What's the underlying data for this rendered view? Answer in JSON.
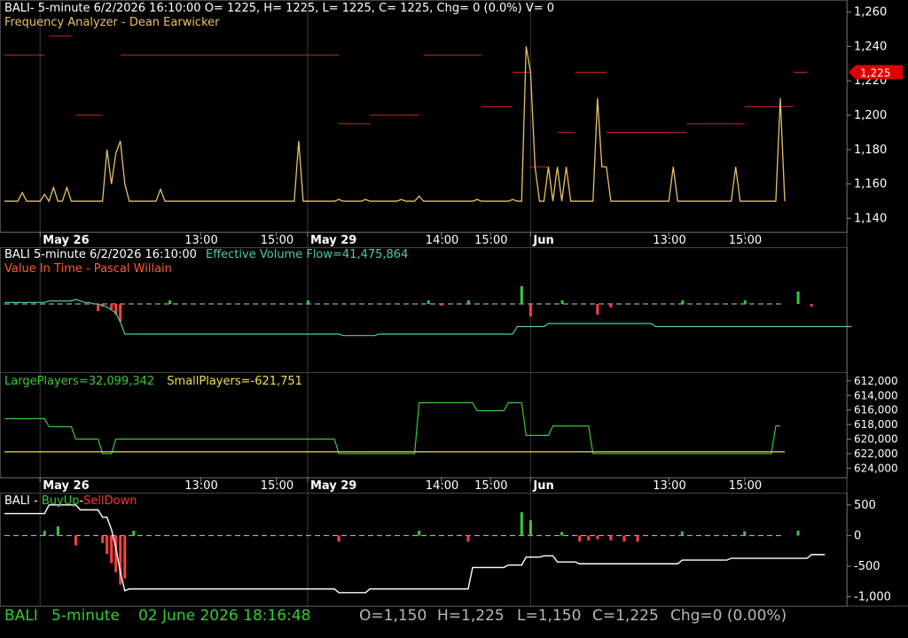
{
  "window": {
    "symbol": "BALI",
    "header1_prefix": "BALI- 5-minute 6/2/2026 16:10:00",
    "ohlc": "O= 1225, H= 1225, L= 1225, C= 1225, Chg= 0 (0.0%) V= 0",
    "indicator1": "Frequency Analyzer - Dean Earwicker",
    "header2": "BALI  5-minute  6/2/2026 16:10:00",
    "evf": "Effective Volume Flow=41,475,864",
    "indicator2": "Value In Time - Pascal Willain",
    "large_players": "LargePlayers=32,099,342",
    "small_players": "SmallPlayers=-621,751",
    "bu_prefix": "BALI - ",
    "bu_buy": "BuyUp",
    "bu_dash": "-",
    "bu_sell": "SellDown"
  },
  "status_bar": {
    "symbol": "BALI",
    "interval": "5-minute",
    "datetime": "02 June 2026 18:16:48",
    "open": "O=1,150",
    "high": "H=1,225",
    "low": "L=1,150",
    "close": "C=1,225",
    "change": "Chg=0 (0.00%)"
  },
  "colors": {
    "background": "#000000",
    "grid": "#3a3a3a",
    "price_line": "#e8c06a",
    "freq_red": "#d42020",
    "green": "#33cc33",
    "teal": "#4ec9b0",
    "red": "#ff4040",
    "white": "#ffffff",
    "yellow": "#f0e040",
    "last_price_badge": "#e00000"
  },
  "chart_data": [
    {
      "type": "line",
      "panel": "price",
      "y_axis_ticks": [
        "1,140",
        "1,160",
        "1,180",
        "1,200",
        "1,220",
        "1,240",
        "1,260"
      ],
      "ylim": [
        1132,
        1267
      ],
      "last_price_label": "1,225",
      "x_tick_labels": [
        "May 26",
        "13:00",
        "15:00",
        "May 29",
        "14:00",
        "15:00",
        "Jun",
        "13:00",
        "15:00"
      ],
      "series": [
        {
          "values": [
            1150,
            1150,
            1150,
            1150,
            1155,
            1150,
            1150,
            1150,
            1150,
            1154,
            1150,
            1158,
            1150,
            1150,
            1158,
            1150,
            1150,
            1150,
            1150,
            1150,
            1150,
            1150,
            1150,
            1180,
            1160,
            1178,
            1185,
            1160,
            1150,
            1150,
            1150,
            1150,
            1150,
            1150,
            1150,
            1157,
            1150,
            1150,
            1150,
            1150,
            1150,
            1150,
            1150,
            1150,
            1150,
            1150,
            1150,
            1150,
            1150,
            1150,
            1150,
            1150,
            1150,
            1150,
            1150,
            1150,
            1150,
            1150,
            1150,
            1150,
            1150,
            1150,
            1150,
            1150,
            1150,
            1150,
            1185,
            1150,
            1150,
            1150,
            1150,
            1150,
            1150,
            1150,
            1150,
            1151,
            1150,
            1150,
            1150,
            1150,
            1150,
            1151,
            1150,
            1150,
            1150,
            1150,
            1150,
            1150,
            1150,
            1151,
            1150,
            1150,
            1150,
            1153,
            1150,
            1150,
            1150,
            1150,
            1150,
            1150,
            1150,
            1150,
            1150,
            1150,
            1150,
            1150,
            1151,
            1150,
            1150,
            1150,
            1150,
            1150,
            1150,
            1150,
            1151,
            1150,
            1150,
            1240,
            1225,
            1170,
            1150,
            1150,
            1170,
            1150,
            1170,
            1150,
            1170,
            1150,
            1150,
            1150,
            1150,
            1150,
            1150,
            1210,
            1170,
            1170,
            1150,
            1150,
            1150,
            1150,
            1150,
            1150,
            1150,
            1150,
            1150,
            1150,
            1150,
            1150,
            1150,
            1150,
            1170,
            1150,
            1150,
            1150,
            1150,
            1150,
            1150,
            1150,
            1150,
            1150,
            1150,
            1150,
            1150,
            1150,
            1170,
            1150,
            1150,
            1150,
            1150,
            1150,
            1150,
            1150,
            1150,
            1150,
            1210,
            1150
          ]
        }
      ],
      "frequency_levels": [
        {
          "from": 0,
          "to": 9,
          "value": 1235
        },
        {
          "from": 10,
          "to": 15,
          "value": 1246
        },
        {
          "from": 16,
          "to": 22,
          "value": 1200
        },
        {
          "from": 26,
          "to": 75,
          "value": 1235
        },
        {
          "from": 75,
          "to": 82,
          "value": 1195
        },
        {
          "from": 82,
          "to": 93,
          "value": 1200
        },
        {
          "from": 94,
          "to": 107,
          "value": 1235
        },
        {
          "from": 107,
          "to": 114,
          "value": 1205
        },
        {
          "from": 114,
          "to": 118,
          "value": 1225
        },
        {
          "from": 118,
          "to": 122,
          "value": 1170
        },
        {
          "from": 124,
          "to": 128,
          "value": 1190
        },
        {
          "from": 128,
          "to": 135,
          "value": 1225
        },
        {
          "from": 135,
          "to": 153,
          "value": 1190
        },
        {
          "from": 153,
          "to": 166,
          "value": 1195
        },
        {
          "from": 166,
          "to": 177,
          "value": 1205
        },
        {
          "from": 177,
          "to": 180,
          "value": 1225
        }
      ]
    },
    {
      "type": "line",
      "panel": "effective-volume-flow",
      "series": [
        {
          "name": "Effective Volume Flow",
          "values": [
            1,
            1,
            1,
            1,
            1,
            1,
            1,
            1,
            1,
            1,
            2,
            2,
            2,
            2,
            2,
            2,
            3,
            2,
            1,
            1,
            0,
            0,
            -1,
            -2,
            -4,
            -6,
            -12,
            -20,
            -20,
            -20,
            -20,
            -20,
            -20,
            -20,
            -20,
            -20,
            -20,
            -20,
            -20,
            -20,
            -20,
            -20,
            -20,
            -20,
            -20,
            -20,
            -20,
            -20,
            -20,
            -20,
            -20,
            -20,
            -20,
            -20,
            -20,
            -20,
            -20,
            -20,
            -20,
            -20,
            -20,
            -20,
            -20,
            -20,
            -20,
            -20,
            -20,
            -20,
            -20,
            -20,
            -20,
            -20,
            -20,
            -20,
            -20,
            -20,
            -21,
            -21,
            -21,
            -21,
            -21,
            -21,
            -21,
            -21,
            -20,
            -20,
            -20,
            -20,
            -20,
            -20,
            -20,
            -20,
            -20,
            -20,
            -20,
            -20,
            -20,
            -20,
            -20,
            -20,
            -20,
            -20,
            -20,
            -20,
            -20,
            -20,
            -20,
            -20,
            -20,
            -20,
            -20,
            -20,
            -20,
            -20,
            -20,
            -15,
            -15,
            -15,
            -15,
            -15,
            -15,
            -15,
            -13,
            -13,
            -13,
            -13,
            -13,
            -13,
            -13,
            -13,
            -13,
            -13,
            -13,
            -13,
            -13,
            -13,
            -13,
            -13,
            -13,
            -13,
            -13,
            -13,
            -13,
            -13,
            -13,
            -13,
            -15,
            -15,
            -15,
            -15,
            -15,
            -15,
            -15,
            -15,
            -15,
            -15,
            -15,
            -15,
            -15,
            -15,
            -15,
            -15,
            -15,
            -15,
            -15,
            -15,
            -15,
            -15,
            -15,
            -15,
            -15,
            -15,
            -15,
            -15,
            -15,
            -15,
            -15,
            -15,
            -15,
            -15,
            -15,
            -15,
            -15,
            -15,
            -15,
            -15,
            -15,
            -15,
            -15,
            -15,
            -15
          ]
        }
      ],
      "bars": [
        0,
        0,
        0,
        0,
        0,
        0,
        0,
        0,
        0,
        0,
        0,
        0,
        0,
        0,
        0,
        0,
        0,
        0,
        0,
        0,
        0,
        0,
        0,
        0,
        0,
        0,
        0,
        0,
        0,
        0,
        0,
        0,
        0,
        0,
        0,
        0,
        0,
        0,
        0,
        0,
        0,
        0,
        0,
        0,
        0,
        0,
        0,
        0,
        0,
        0,
        0,
        0,
        0,
        0,
        0,
        0,
        0,
        0,
        0,
        0,
        0,
        0,
        0,
        0,
        0,
        0,
        0,
        0,
        0,
        0,
        0,
        0,
        0,
        0,
        0,
        0,
        0,
        0,
        0,
        0,
        0,
        0,
        0,
        0,
        0,
        0,
        0,
        0,
        0,
        0,
        0,
        0,
        0,
        0,
        0,
        0,
        0,
        0,
        0,
        0,
        0,
        0,
        0,
        0,
        0,
        0,
        0,
        0,
        0,
        0,
        0,
        0,
        0,
        0,
        0,
        0,
        0,
        0,
        0,
        0,
        0,
        0,
        0,
        0,
        0,
        0,
        0,
        0,
        0,
        0,
        0,
        0,
        0,
        0,
        0,
        0,
        0,
        0,
        0,
        0,
        0,
        0,
        0,
        0,
        0,
        0,
        0,
        0,
        0,
        0,
        0,
        0,
        0,
        0,
        0,
        0,
        0,
        0,
        0,
        0,
        0,
        0,
        0,
        0,
        0,
        0,
        0,
        0,
        0,
        0,
        0,
        0,
        0,
        0,
        0,
        0,
        0,
        0,
        0,
        0
      ]
    },
    {
      "type": "line",
      "panel": "large-small-players",
      "y_axis_ticks": [
        "612,000",
        "614,000",
        "616,000",
        "618,000",
        "620,000",
        "622,000",
        "624,000"
      ],
      "ylim": [
        625300,
        610800
      ],
      "series": [
        {
          "name": "LargePlayers",
          "values": [
            617200,
            617200,
            617200,
            617200,
            617200,
            617200,
            617200,
            617200,
            617200,
            617200,
            618300,
            618300,
            618300,
            618300,
            618300,
            618300,
            620000,
            620000,
            620000,
            620000,
            620000,
            620000,
            622000,
            622000,
            622000,
            620000,
            620000,
            620000,
            620000,
            620000,
            620000,
            620000,
            620000,
            620000,
            620000,
            620000,
            620000,
            620000,
            620000,
            620000,
            620000,
            620000,
            620000,
            620000,
            620000,
            620000,
            620000,
            620000,
            620000,
            620000,
            620000,
            620000,
            620000,
            620000,
            620000,
            620000,
            620000,
            620000,
            620000,
            620000,
            620000,
            620000,
            620000,
            620000,
            620000,
            620000,
            620000,
            620000,
            620000,
            620000,
            620000,
            620000,
            620000,
            620000,
            620000,
            622000,
            622000,
            622000,
            622000,
            622000,
            622000,
            622000,
            622000,
            622000,
            622000,
            622000,
            622000,
            622000,
            622000,
            622000,
            622000,
            622000,
            622000,
            615000,
            615000,
            615000,
            615000,
            615000,
            615000,
            615000,
            615000,
            615000,
            615000,
            615000,
            615000,
            615000,
            616100,
            616100,
            616100,
            616100,
            616100,
            616100,
            616100,
            615000,
            615000,
            615000,
            615000,
            619500,
            619500,
            619500,
            619500,
            619500,
            619500,
            618200,
            618200,
            618200,
            618200,
            618200,
            618200,
            618200,
            618200,
            618200,
            622000,
            622000,
            622000,
            622000,
            622000,
            622000,
            622000,
            622000,
            622000,
            622000,
            622000,
            622000,
            622000,
            622000,
            622000,
            622000,
            622000,
            622000,
            622000,
            622000,
            622000,
            622000,
            622000,
            622000,
            622000,
            622000,
            622000,
            622000,
            622000,
            622000,
            622000,
            622000,
            622000,
            622000,
            622000,
            622000,
            622000,
            622000,
            622000,
            622000,
            622000,
            618200,
            618200
          ]
        },
        {
          "name": "SmallPlayers",
          "values": [
            621751,
            621751
          ]
        }
      ]
    },
    {
      "type": "line",
      "panel": "buyup-selldown",
      "y_axis_ticks": [
        "500",
        "0",
        "-500",
        "-1,000"
      ],
      "ylim": [
        -1150,
        700
      ],
      "series": [
        {
          "name": "BuyUp-SellDown",
          "values": [
            360,
            360,
            360,
            360,
            360,
            360,
            360,
            360,
            360,
            360,
            500,
            500,
            500,
            500,
            500,
            500,
            500,
            420,
            420,
            420,
            420,
            420,
            300,
            300,
            100,
            -200,
            -600,
            -900,
            -870,
            -870,
            -870,
            -870,
            -870,
            -870,
            -870,
            -870,
            -870,
            -870,
            -870,
            -870,
            -870,
            -870,
            -870,
            -870,
            -870,
            -870,
            -870,
            -870,
            -870,
            -870,
            -870,
            -870,
            -870,
            -870,
            -870,
            -870,
            -870,
            -870,
            -870,
            -870,
            -870,
            -870,
            -870,
            -870,
            -870,
            -870,
            -870,
            -870,
            -870,
            -870,
            -870,
            -870,
            -870,
            -870,
            -870,
            -930,
            -930,
            -930,
            -930,
            -930,
            -930,
            -930,
            -870,
            -870,
            -870,
            -870,
            -870,
            -870,
            -870,
            -870,
            -870,
            -870,
            -870,
            -870,
            -870,
            -870,
            -870,
            -870,
            -870,
            -870,
            -870,
            -870,
            -870,
            -870,
            -870,
            -520,
            -520,
            -520,
            -520,
            -520,
            -520,
            -520,
            -520,
            -480,
            -480,
            -480,
            -480,
            -350,
            -350,
            -350,
            -350,
            -330,
            -330,
            -330,
            -430,
            -430,
            -430,
            -430,
            -430,
            -460,
            -460,
            -460,
            -460,
            -460,
            -460,
            -460,
            -460,
            -460,
            -460,
            -460,
            -460,
            -460,
            -460,
            -460,
            -460,
            -460,
            -460,
            -460,
            -460,
            -460,
            -460,
            -460,
            -400,
            -400,
            -400,
            -400,
            -400,
            -400,
            -400,
            -400,
            -400,
            -400,
            -400,
            -370,
            -370,
            -370,
            -370,
            -370,
            -370,
            -370,
            -370,
            -370,
            -370,
            -370,
            -370,
            -370,
            -370,
            -370,
            -370,
            -370,
            -370,
            -310,
            -310,
            -310,
            -310
          ]
        }
      ]
    }
  ]
}
